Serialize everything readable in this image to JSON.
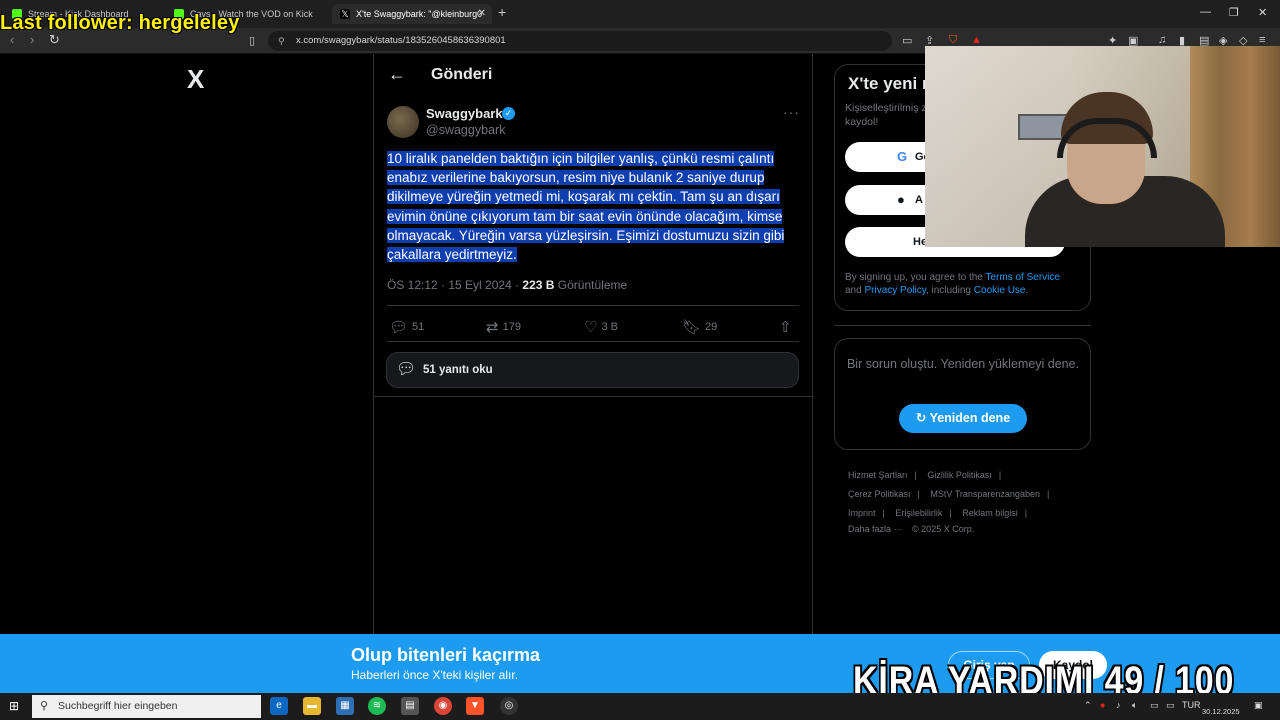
{
  "overlay": {
    "last_follower": "Last follower: hergeleley",
    "goal": "KİRA YARDIMI  49 / 100"
  },
  "browser": {
    "tabs": [
      {
        "label": "Stream - Kick Dashboard",
        "icon_color": "#53fc18"
      },
      {
        "label": "Cavs - Watch the VOD on Kick",
        "icon_color": "#53fc18"
      },
      {
        "label": "X'te Swaggybark: \"@kleinburg0",
        "icon_color": "#ffffff"
      }
    ],
    "url": "x.com/swaggybark/status/1835260458636390801"
  },
  "x": {
    "logo": "X",
    "page_title": "Gönderi",
    "author": {
      "name": "Swaggybark",
      "handle": "@swaggybark"
    },
    "tweet_text": "10 liralık panelden baktığın için bilgiler yanlış, çünkü resmi çalıntı enabız verilerine bakıyorsun, resim niye bulanık 2 saniye durup dikilmeye yüreğin yetmedi mi, koşarak mı çektin. Tam şu an dışarı evimin önüne çıkıyorum tam bir saat evin önünde olacağım, kimse olmayacak. Yüreğin varsa yüzleşirsin. Eşimizi dostumuzu sizin gibi çakallara yedirtmeyiz.",
    "meta_time": "ÖS 12:12 · 15 Eyl 2024 · ",
    "views_count": "223 B",
    "views_label": "Görüntüleme",
    "actions": {
      "replies": "51",
      "retweets": "179",
      "likes": "3 B",
      "bookmarks": "29"
    },
    "read_replies": "51 yanıtı oku"
  },
  "sidebar": {
    "signup_title": "X'te yeni m",
    "signup_sub_1": "Kişiselleştirilmiş z",
    "signup_sub_2": "kaydol!",
    "google_btn": "Go",
    "apple_btn": "A",
    "create_btn": "He",
    "terms_prefix": "By signing up, you agree to the ",
    "terms_link": "Terms of Service",
    "terms_and": "and ",
    "privacy_link": "Privacy Policy",
    "terms_including": ", including ",
    "cookie_link": "Cookie Use",
    "terms_end": ".",
    "error_text": "Bir sorun oluştu. Yeniden yüklemeyi dene.",
    "retry_label": "Yeniden dene",
    "footer": [
      "Hizmet Şartları",
      "Gizlilik Politikası",
      "Çerez Politikası",
      "MStV Transparenzangaben",
      "Imprint",
      "Erişilebilirlik",
      "Reklam bilgisi",
      "Daha fazla ···",
      "© 2025 X Corp."
    ]
  },
  "banner": {
    "title": "Olup bitenleri kaçırma",
    "subtitle": "Haberleri önce X'teki kişiler alır.",
    "login": "Giriş yap",
    "signup": "Kaydol"
  },
  "taskbar": {
    "search_placeholder": "Suchbegriff hier eingeben",
    "lang": "TUR",
    "date": "30.12.2025"
  }
}
